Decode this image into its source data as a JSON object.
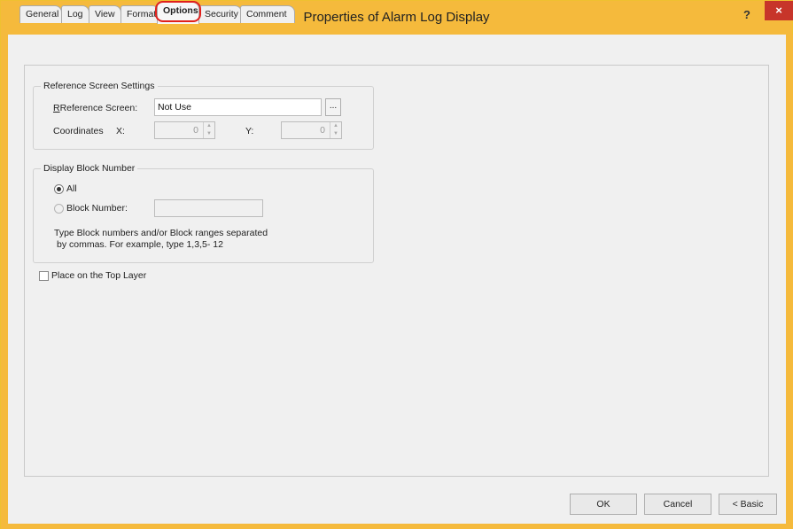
{
  "window": {
    "title": "Properties of Alarm Log Display",
    "help_label": "?",
    "close_label": "×"
  },
  "tabs": [
    {
      "label": "General"
    },
    {
      "label": "Log"
    },
    {
      "label": "View"
    },
    {
      "label": "Format"
    },
    {
      "label": "Options"
    },
    {
      "label": "Security"
    },
    {
      "label": "Comment"
    }
  ],
  "reference_screen_settings": {
    "group_label": "Reference Screen Settings",
    "reference_screen_label": "Reference Screen:",
    "reference_screen_value": "Not Use",
    "browse_label": "...",
    "coordinates_label": "Coordinates",
    "x_label": "X:",
    "x_value": "0",
    "y_label": "Y:",
    "y_value": "0"
  },
  "display_block_number": {
    "group_label": "Display Block Number",
    "all_label": "All",
    "block_number_label": "Block Number:",
    "block_number_value": "",
    "description_line1": "Type Block numbers and/or Block ranges separated",
    "description_line2": "by commas. For example, type 1,3,5- 12"
  },
  "top_layer": {
    "label": "Place on the Top Layer",
    "checked": false
  },
  "footer": {
    "ok_label": "OK",
    "cancel_label": "Cancel",
    "basic_label": "< Basic"
  }
}
